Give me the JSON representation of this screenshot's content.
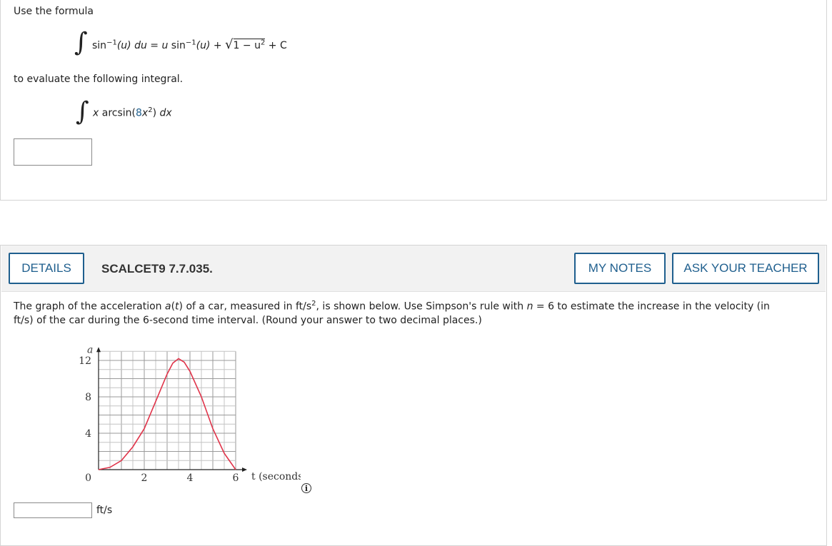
{
  "q1": {
    "intro": "Use the formula",
    "formula": {
      "integrand_fn": "sin",
      "exp": "−1",
      "arg": "(u)",
      "du": "du",
      "eq": "=",
      "u": "u",
      "fn2": "sin",
      "arg2": "(u)",
      "plus": "+",
      "sqrt_body": "1 − u",
      "sqrt_exp": "2",
      "const": "+ C"
    },
    "middle": "to evaluate the following integral.",
    "integral": {
      "x": "x",
      "fn": "arcsin(",
      "coef": "8",
      "var": "x",
      "exp": "2",
      "close": ")",
      "dx": "dx"
    },
    "answer_value": ""
  },
  "q2": {
    "details_label": "DETAILS",
    "code": "SCALCET9 7.7.035.",
    "my_notes_label": "MY NOTES",
    "ask_teacher_label": "ASK YOUR TEACHER",
    "text_line1_a": "The graph of the acceleration ",
    "text_line1_at": "a",
    "text_line1_b": "(",
    "text_line1_t": "t",
    "text_line1_c": ") of a car, measured in ft/s",
    "text_line1_exp": "2",
    "text_line1_d": ", is shown below. Use Simpson's rule with ",
    "text_line1_n": "n",
    "text_line1_e": " = 6 to estimate the increase in the velocity (in",
    "text_line2": "ft/s) of the car during the 6-second time interval. (Round your answer to two decimal places.)",
    "answer_value": "",
    "unit": "ft/s",
    "info_glyph": "i"
  },
  "chart_data": {
    "type": "line",
    "xlabel": "t (seconds)",
    "ylabel": "a",
    "xlim": [
      0,
      6
    ],
    "ylim": [
      0,
      13
    ],
    "x_ticks": [
      "2",
      "4",
      "6"
    ],
    "y_ticks": [
      "12",
      "8",
      "4"
    ],
    "origin_label": "0",
    "grid": true,
    "series": [
      {
        "color": "#e0344a",
        "x": [
          0,
          0.5,
          1,
          1.5,
          2,
          2.5,
          3,
          3.25,
          3.5,
          3.75,
          4,
          4.5,
          5,
          5.5,
          6
        ],
        "y": [
          0,
          0.25,
          1,
          2.5,
          4.5,
          7.5,
          10.5,
          11.7,
          12.2,
          11.8,
          10.8,
          8,
          4.5,
          1.8,
          0
        ]
      }
    ],
    "axis_label_font": "serif"
  }
}
